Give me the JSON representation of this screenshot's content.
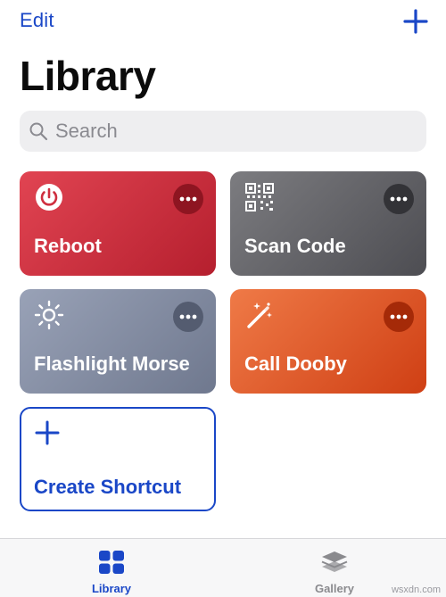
{
  "nav": {
    "edit_label": "Edit"
  },
  "page": {
    "title": "Library"
  },
  "search": {
    "placeholder": "Search"
  },
  "shortcuts": [
    {
      "label": "Reboot",
      "icon": "power-icon",
      "color": "#c92a3a"
    },
    {
      "label": "Scan Code",
      "icon": "qr-code-icon",
      "color": "#5e5e63"
    },
    {
      "label": "Flashlight Morse",
      "icon": "sun-icon",
      "color": "#7f889e"
    },
    {
      "label": "Call Dooby",
      "icon": "magic-wand-icon",
      "color": "#df5a2b"
    }
  ],
  "create": {
    "label": "Create Shortcut"
  },
  "tabs": [
    {
      "label": "Library",
      "icon": "grid-icon",
      "active": true
    },
    {
      "label": "Gallery",
      "icon": "layers-icon",
      "active": false
    }
  ],
  "colors": {
    "accent": "#1a47c7",
    "search_bg": "#eeeef0"
  },
  "watermark": "wsxdn.com"
}
